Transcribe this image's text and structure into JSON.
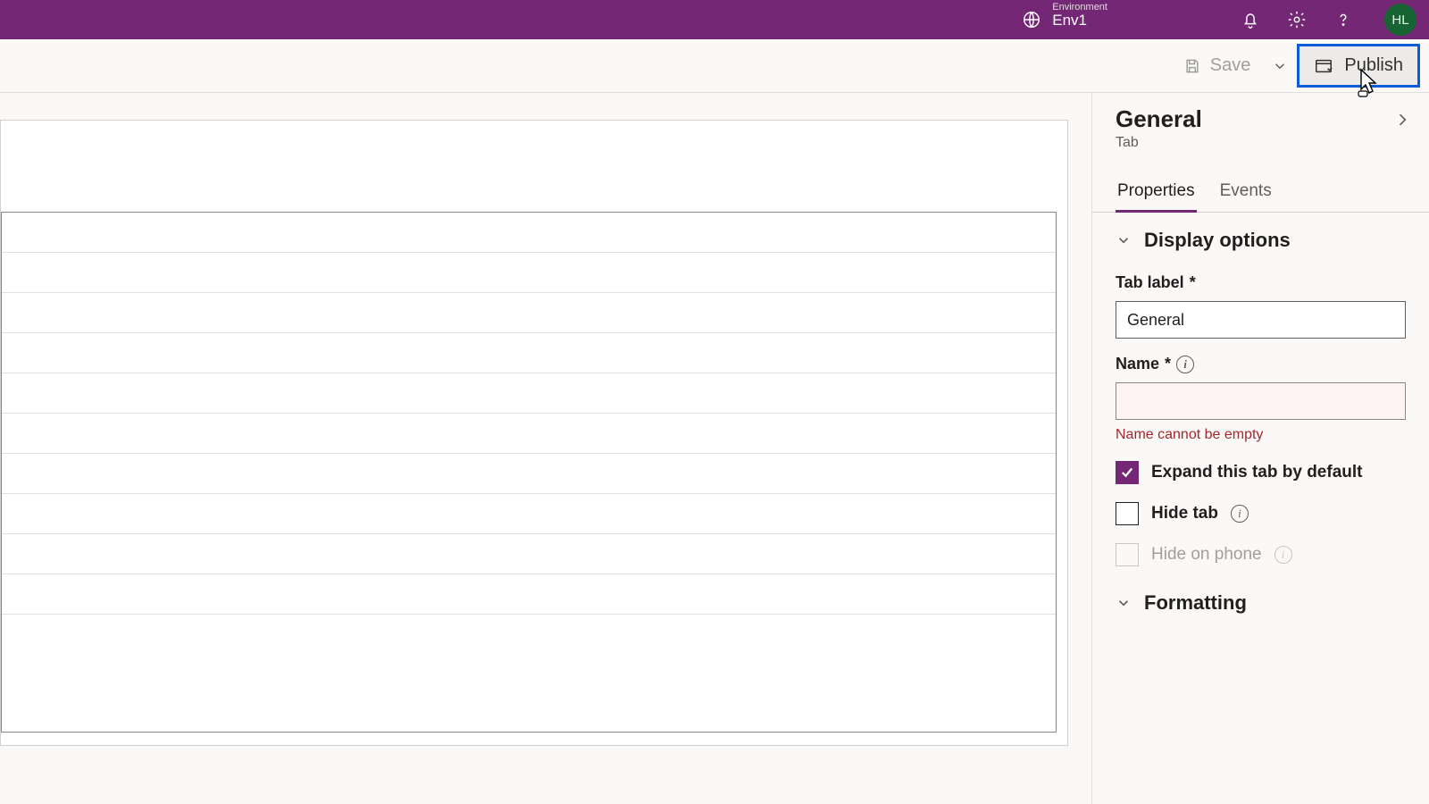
{
  "header": {
    "env_label": "Environment",
    "env_value": "Env1",
    "avatar_initials": "HL"
  },
  "commands": {
    "save_label": "Save",
    "publish_label": "Publish"
  },
  "panel": {
    "title": "General",
    "subtitle": "Tab",
    "tabs": {
      "properties": "Properties",
      "events": "Events"
    },
    "display_options": {
      "section_title": "Display options",
      "tab_label_label": "Tab label",
      "tab_label_value": "General",
      "name_label": "Name",
      "name_value": "",
      "name_error": "Name cannot be empty",
      "expand_label": "Expand this tab by default",
      "hide_label": "Hide tab",
      "hide_phone_label": "Hide on phone"
    },
    "formatting": {
      "section_title": "Formatting"
    }
  }
}
